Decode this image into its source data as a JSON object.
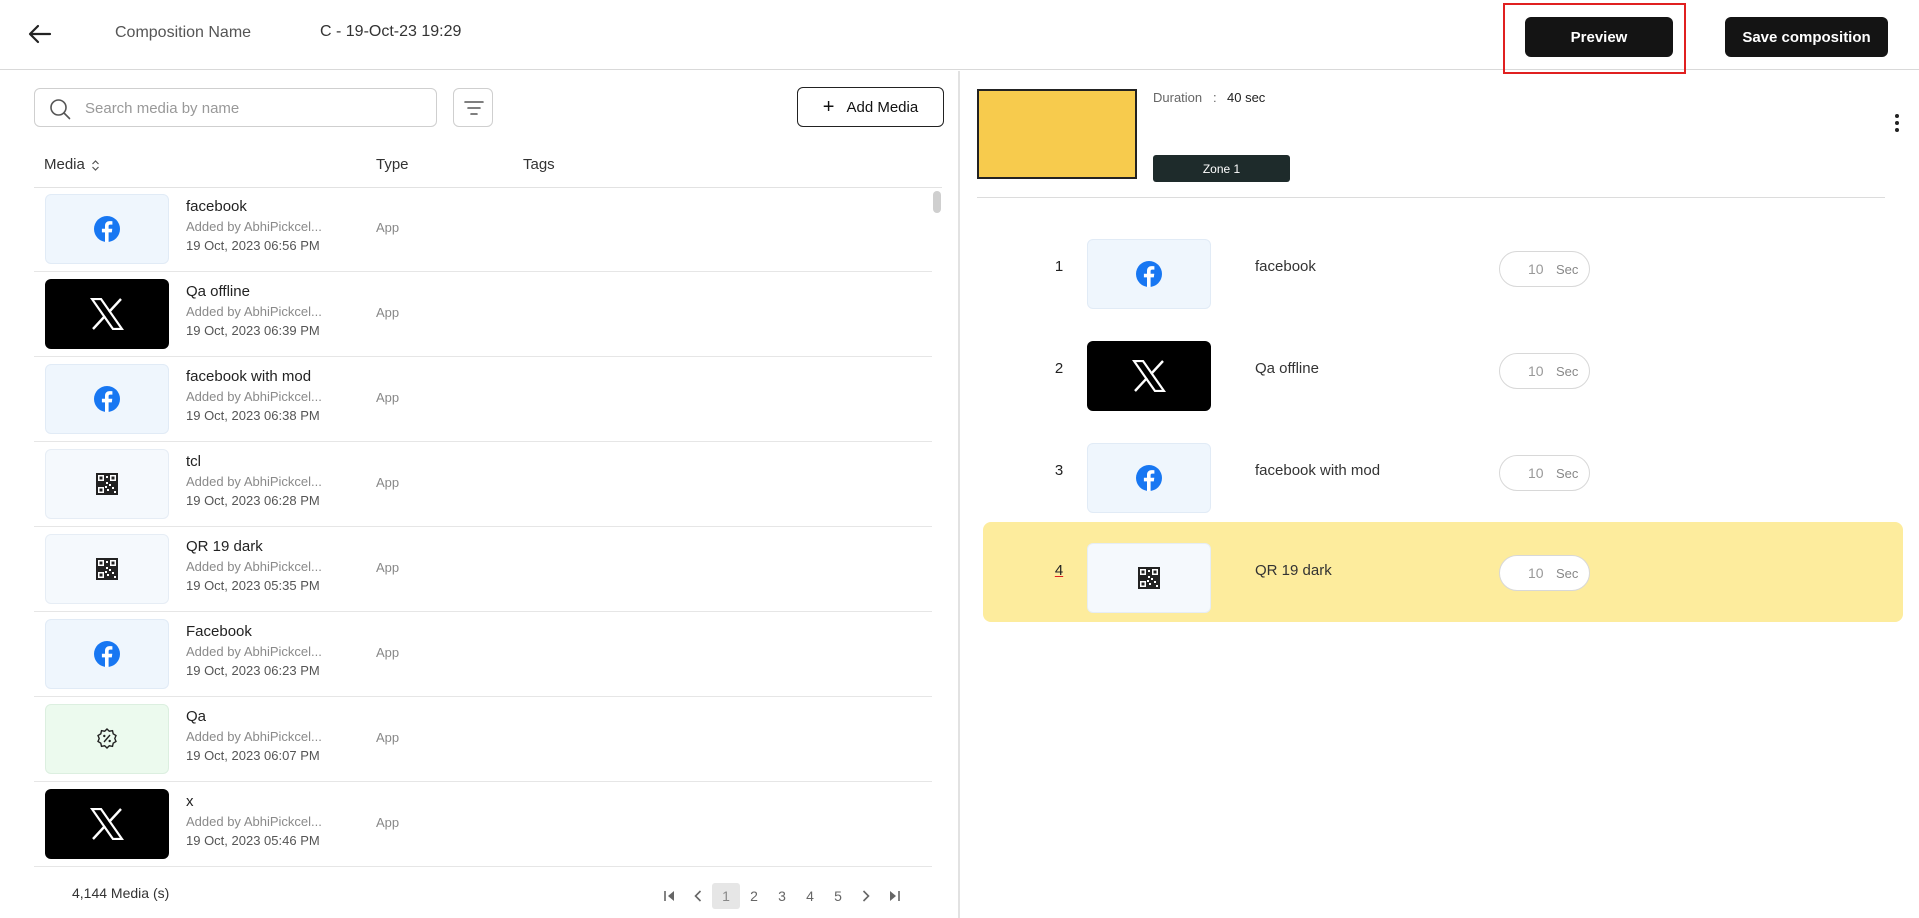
{
  "header": {
    "composition_label": "Composition Name",
    "composition_value": "C - 19-Oct-23 19:29",
    "preview_label": "Preview",
    "save_label": "Save composition"
  },
  "library": {
    "search_placeholder": "Search media by name",
    "add_media_label": "Add Media",
    "columns": {
      "media": "Media",
      "type": "Type",
      "tags": "Tags"
    },
    "items": [
      {
        "name": "facebook",
        "added_by": "Added by AbhiPickcel...",
        "date": "19 Oct, 2023 06:56 PM",
        "type": "App",
        "icon": "facebook-icon"
      },
      {
        "name": "Qa offline",
        "added_by": "Added by AbhiPickcel...",
        "date": "19 Oct, 2023 06:39 PM",
        "type": "App",
        "icon": "x-logo-icon"
      },
      {
        "name": "facebook with mod",
        "added_by": "Added by AbhiPickcel...",
        "date": "19 Oct, 2023 06:38 PM",
        "type": "App",
        "icon": "facebook-icon"
      },
      {
        "name": "tcl",
        "added_by": "Added by AbhiPickcel...",
        "date": "19 Oct, 2023 06:28 PM",
        "type": "App",
        "icon": "qr-code-icon"
      },
      {
        "name": "QR 19 dark",
        "added_by": "Added by AbhiPickcel...",
        "date": "19 Oct, 2023 05:35 PM",
        "type": "App",
        "icon": "qr-code-icon"
      },
      {
        "name": "Facebook",
        "added_by": "Added by AbhiPickcel...",
        "date": "19 Oct, 2023 06:23 PM",
        "type": "App",
        "icon": "facebook-icon"
      },
      {
        "name": "Qa",
        "added_by": "Added by AbhiPickcel...",
        "date": "19 Oct, 2023 06:07 PM",
        "type": "App",
        "icon": "discount-badge-icon"
      },
      {
        "name": "x",
        "added_by": "Added by AbhiPickcel...",
        "date": "19 Oct, 2023 05:46 PM",
        "type": "App",
        "icon": "x-logo-icon"
      }
    ],
    "footer_count": "4,144 Media (s)",
    "pages": [
      "1",
      "2",
      "3",
      "4",
      "5"
    ],
    "current_page": "1"
  },
  "composition": {
    "duration_label": "Duration",
    "duration_separator": ":",
    "duration_value": "40 sec",
    "zone_label": "Zone 1",
    "zone_color": "#f7cb4d",
    "playlist": [
      {
        "index": "1",
        "name": "facebook",
        "duration": "10",
        "unit": "Sec",
        "icon": "facebook-icon"
      },
      {
        "index": "2",
        "name": "Qa offline",
        "duration": "10",
        "unit": "Sec",
        "icon": "x-logo-icon"
      },
      {
        "index": "3",
        "name": "facebook with mod",
        "duration": "10",
        "unit": "Sec",
        "icon": "facebook-icon"
      },
      {
        "index": "4",
        "name": "QR 19 dark",
        "duration": "10",
        "unit": "Sec",
        "icon": "qr-code-icon",
        "selected": true
      }
    ]
  },
  "colors": {
    "accent_dark": "#141414",
    "highlight_row": "#fdec9d",
    "annotation_red": "#e02020",
    "facebook_blue": "#1877f2"
  }
}
